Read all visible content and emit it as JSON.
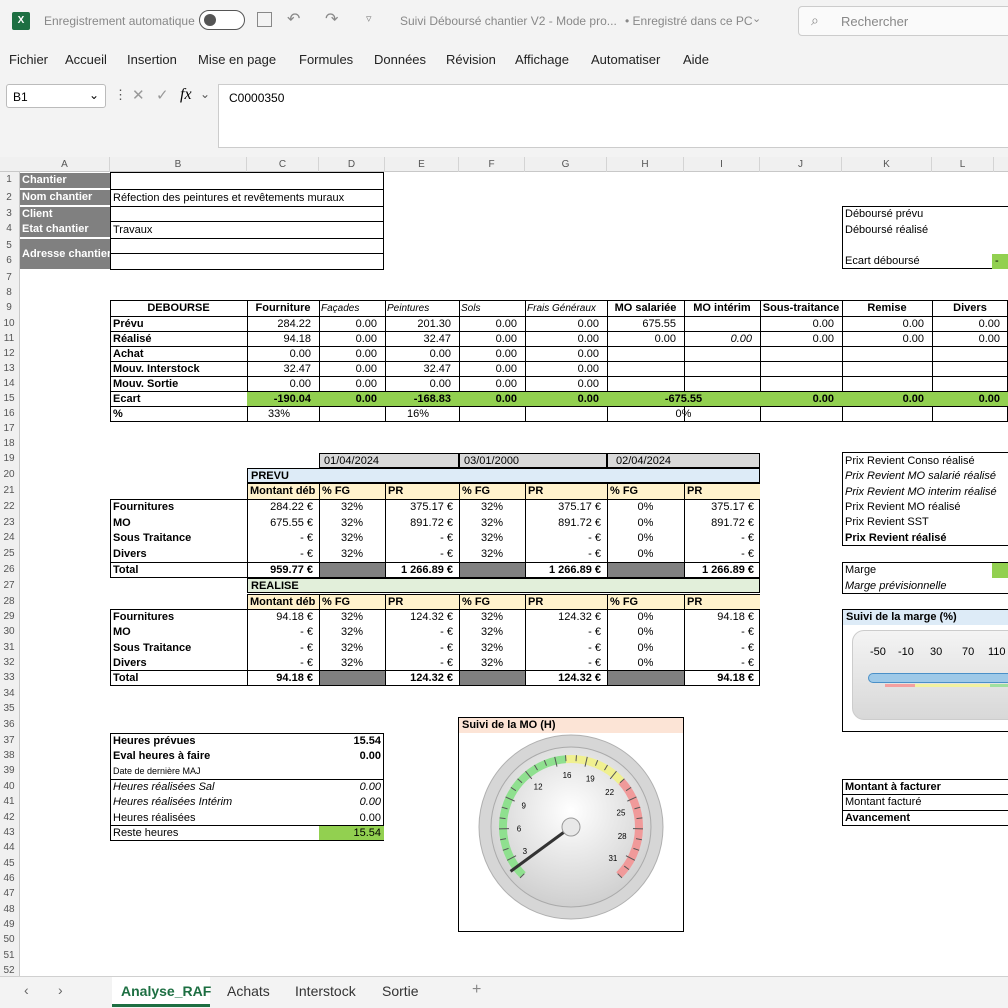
{
  "app": {
    "autosave_label": "Enregistrement automatique",
    "title": "Suivi Déboursé chantier V2 - Mode pro...",
    "saved": "• Enregistré dans ce PC",
    "search_placeholder": "Rechercher"
  },
  "menu": [
    "Fichier",
    "Accueil",
    "Insertion",
    "Mise en page",
    "Formules",
    "Données",
    "Révision",
    "Affichage",
    "Automatiser",
    "Aide"
  ],
  "formula": {
    "cell": "B1",
    "fx": "fx",
    "value": "C0000350"
  },
  "columns": [
    "A",
    "B",
    "C",
    "D",
    "E",
    "F",
    "G",
    "H",
    "I",
    "J",
    "K",
    "L"
  ],
  "rows": [
    "1",
    "2",
    "3",
    "4",
    "5",
    "6",
    "7",
    "8",
    "9",
    "10",
    "11",
    "12",
    "13",
    "14",
    "15",
    "16",
    "17",
    "18",
    "19",
    "20",
    "21",
    "22",
    "23",
    "24",
    "25",
    "26",
    "27",
    "28",
    "29",
    "30",
    "31",
    "32",
    "33",
    "34",
    "35",
    "36",
    "37",
    "38",
    "39",
    "40",
    "41",
    "42",
    "43",
    "44",
    "45",
    "46",
    "47",
    "48",
    "49",
    "50",
    "51",
    "52"
  ],
  "info": {
    "labels": [
      "Chantier",
      "Nom chantier",
      "Client",
      "Etat chantier",
      "Adresse chantier"
    ],
    "nom": "Réfection des peintures et revêtements muraux",
    "etat": "Travaux"
  },
  "deb_right": {
    "prevu": "Déboursé prévu",
    "realise": "Déboursé réalisé",
    "ecart": "Ecart déboursé",
    "dash": "-"
  },
  "debourse": {
    "headers": [
      "DEBOURSE",
      "Fourniture",
      "Façades",
      "Peintures",
      "Sols",
      "Frais Généraux",
      "MO salariée",
      "MO intérim",
      "Sous-traitance",
      "Remise",
      "Divers"
    ],
    "rows": [
      [
        "Prévu",
        "284.22",
        "0.00",
        "201.30",
        "0.00",
        "0.00",
        "675.55",
        "",
        "0.00",
        "0.00",
        "0.00"
      ],
      [
        "Réalisé",
        "94.18",
        "0.00",
        "32.47",
        "0.00",
        "0.00",
        "0.00",
        "0.00",
        "0.00",
        "0.00",
        "0.00"
      ],
      [
        "Achat",
        "0.00",
        "0.00",
        "0.00",
        "0.00",
        "0.00",
        "",
        "",
        "",
        "",
        ""
      ],
      [
        "Mouv. Interstock",
        "32.47",
        "0.00",
        "32.47",
        "0.00",
        "0.00",
        "",
        "",
        "",
        "",
        ""
      ],
      [
        "Mouv. Sortie",
        "0.00",
        "0.00",
        "0.00",
        "0.00",
        "0.00",
        "",
        "",
        "",
        "",
        ""
      ],
      [
        "Ecart",
        "-190.04",
        "0.00",
        "-168.83",
        "0.00",
        "0.00",
        "-675.55",
        "",
        "0.00",
        "0.00",
        "0.00"
      ],
      [
        "%",
        "33%",
        "",
        "16%",
        "",
        "",
        "0%",
        "",
        "",
        "",
        ""
      ]
    ]
  },
  "dates": [
    "01/04/2024",
    "03/01/2000",
    "02/04/2024"
  ],
  "prevu": {
    "title": "PREVU",
    "realise_title": "REALISE",
    "sub": [
      "Montant déb",
      "% FG",
      "PR",
      "% FG",
      "PR",
      "% FG",
      "PR"
    ],
    "rows": [
      [
        "Fournitures",
        "284.22 €",
        "32%",
        "375.17 €",
        "32%",
        "375.17 €",
        "0%",
        "375.17 €"
      ],
      [
        "MO",
        "675.55 €",
        "32%",
        "891.72 €",
        "32%",
        "891.72 €",
        "0%",
        "891.72 €"
      ],
      [
        "Sous Traitance",
        "-   €",
        "32%",
        "-   €",
        "32%",
        "-   €",
        "0%",
        "-   €"
      ],
      [
        "Divers",
        "-   €",
        "32%",
        "-   €",
        "32%",
        "-   €",
        "0%",
        "-   €"
      ],
      [
        "Total",
        "959.77 €",
        "",
        "1 266.89 €",
        "",
        "1 266.89 €",
        "",
        "1 266.89 €"
      ]
    ],
    "rrows": [
      [
        "Fournitures",
        "94.18 €",
        "32%",
        "124.32 €",
        "32%",
        "124.32 €",
        "0%",
        "94.18 €"
      ],
      [
        "MO",
        "-   €",
        "32%",
        "-   €",
        "32%",
        "-   €",
        "0%",
        "-   €"
      ],
      [
        "Sous Traitance",
        "-   €",
        "32%",
        "-   €",
        "32%",
        "-   €",
        "0%",
        "-   €"
      ],
      [
        "Divers",
        "-   €",
        "32%",
        "-   €",
        "32%",
        "-   €",
        "0%",
        "-   €"
      ],
      [
        "Total",
        "94.18 €",
        "",
        "124.32 €",
        "",
        "124.32 €",
        "",
        "94.18 €"
      ]
    ]
  },
  "prix": [
    "Prix Revient Conso réalisé",
    "Prix Revient MO salarié réalisé",
    "Prix Revient MO interim réalisé",
    "Prix Revient MO réalisé",
    "Prix Revient SST",
    "Prix Revient réalisé"
  ],
  "marge": [
    "Marge",
    "Marge prévisionnelle"
  ],
  "suivi_marge": {
    "title": "Suivi de la marge (%)",
    "ticks": [
      "-50",
      "-10",
      "30",
      "70",
      "110"
    ]
  },
  "heures": {
    "rows": [
      [
        "Heures prévues",
        "15.54"
      ],
      [
        "Eval heures à faire",
        "0.00"
      ],
      [
        "Date de dernière MAJ",
        ""
      ],
      [
        "Heures réalisées Sal",
        "0.00"
      ],
      [
        "Heures réalisées Intérim",
        "0.00"
      ],
      [
        "Heures réalisées",
        "0.00"
      ],
      [
        "Reste heures",
        "15.54"
      ]
    ]
  },
  "gauge": {
    "title": "Suivi de la MO (H)",
    "ticks": [
      "3",
      "6",
      "9",
      "12",
      "16",
      "19",
      "22",
      "25",
      "28",
      "31"
    ],
    "value": 2
  },
  "facture": [
    "Montant à facturer",
    "Montant facturé",
    "Avancement"
  ],
  "sheets": [
    "Analyse_RAF",
    "Achats",
    "Interstock",
    "Sortie"
  ]
}
